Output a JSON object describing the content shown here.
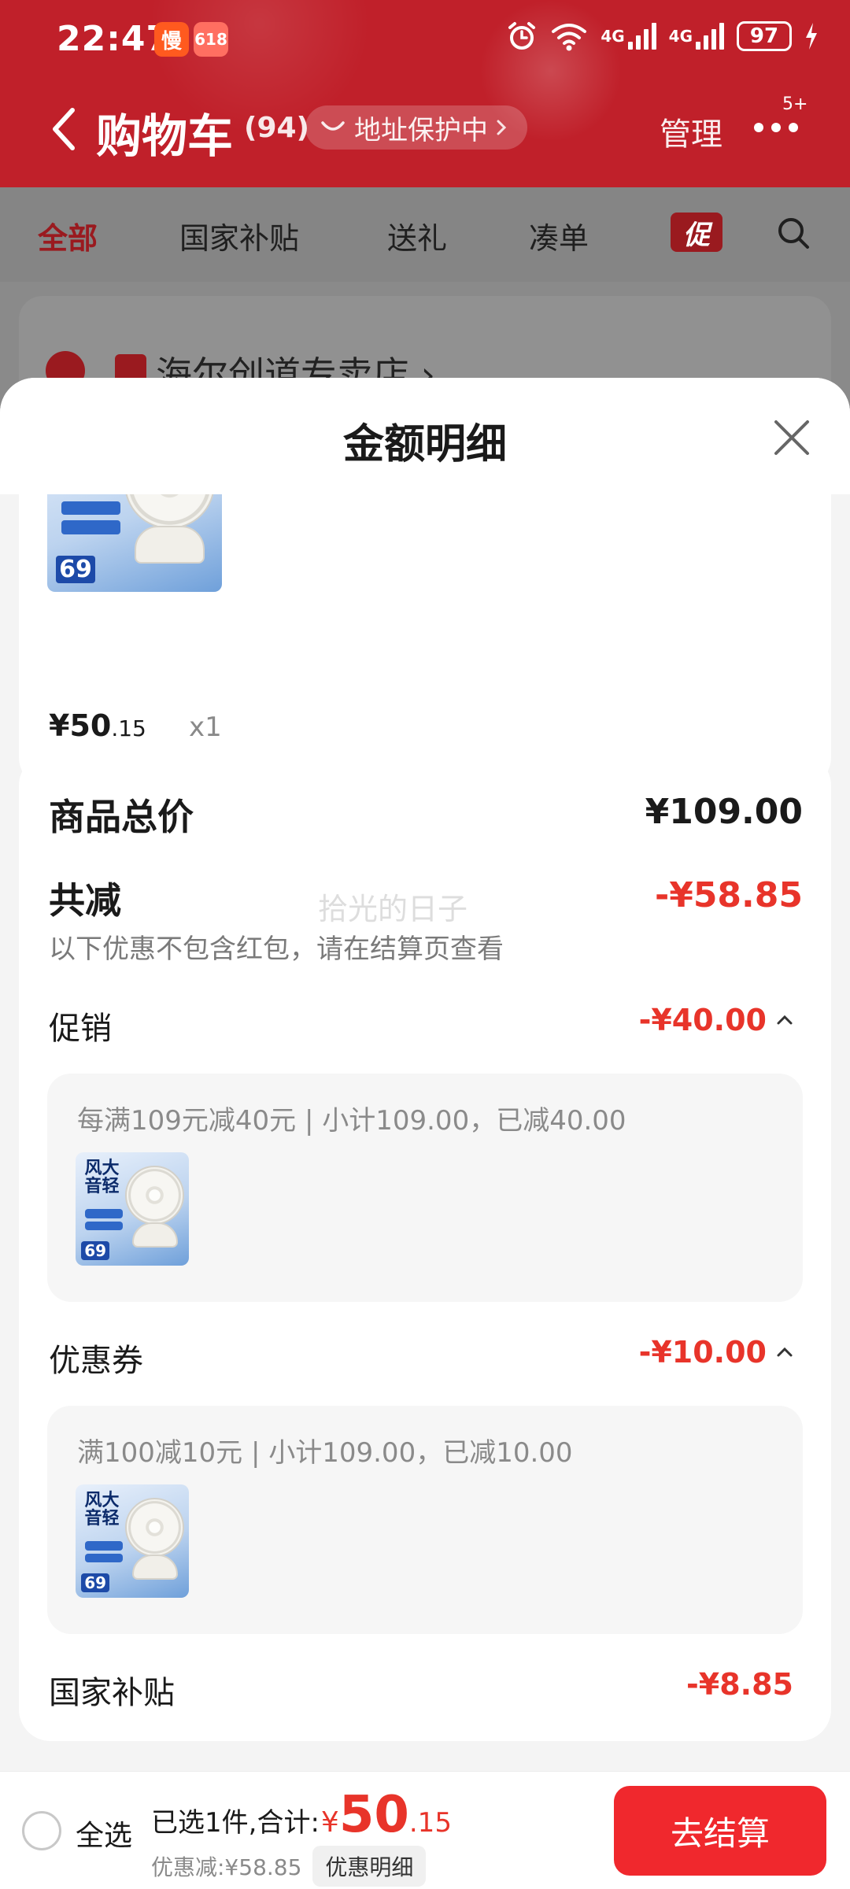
{
  "status_bar": {
    "time": "22:47",
    "app_badge_1": "慢",
    "app_badge_2": "618",
    "net1_label": "4G",
    "net2_label": "4G",
    "battery": "97"
  },
  "header": {
    "title": "购物车",
    "count": "(94)",
    "address_protect": "地址保护中",
    "manage": "管理",
    "more_badge": "5+"
  },
  "tabs": [
    {
      "label": "全部"
    },
    {
      "label": "国家补贴"
    },
    {
      "label": "送礼"
    },
    {
      "label": "凑单"
    }
  ],
  "promo_chip": "促",
  "store": {
    "name": "海尔创道专卖店 ›"
  },
  "sheet": {
    "title": "金额明细",
    "item": {
      "thumb_text": "风大\n音轻",
      "thumb_price": "69",
      "price_main": "¥50",
      "price_dec": ".15",
      "qty": "x1"
    },
    "summary": {
      "total_label": "商品总价",
      "total_value": "¥109.00",
      "reduce_label": "共减",
      "reduce_value": "-¥58.85",
      "reduce_note": "以下优惠不包含红包，请在结算页查看",
      "watermark": "拾光的日子"
    },
    "promotion": {
      "label": "促销",
      "value": "-¥40.00",
      "detail": "每满109元减40元 | 小计109.00，已减40.00"
    },
    "coupon": {
      "label": "优惠券",
      "value": "-¥10.00",
      "detail": "满100减10元 | 小计109.00，已减10.00"
    },
    "subsidy": {
      "label": "国家补贴",
      "value": "-¥8.85"
    }
  },
  "bottom": {
    "select_all": "全选",
    "selected_text": "已选1件,合计:",
    "currency": "¥",
    "total_int": "50",
    "total_dec": ".15",
    "discount_text": "优惠减:¥58.85",
    "discount_chip": "优惠明细",
    "checkout": "去结算"
  },
  "colors": {
    "header_red": "#c0202a",
    "accent_red": "#e8342a",
    "checkout_red": "#f0282d"
  }
}
